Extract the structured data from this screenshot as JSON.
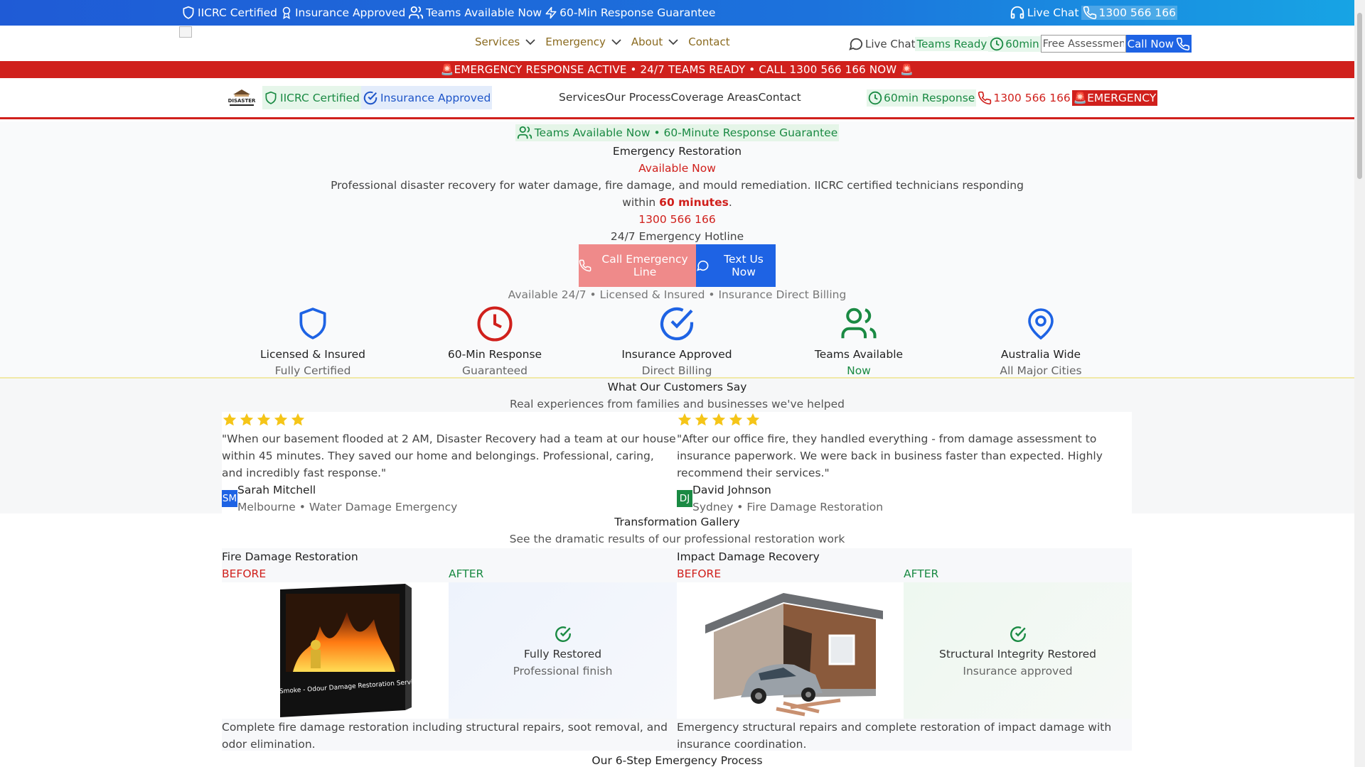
{
  "topbar": {
    "iicrc": "IICRC Certified",
    "insurance": "Insurance Approved",
    "teams": "Teams Available Now",
    "guarantee": "60-Min Response Guarantee",
    "live_chat": "Live Chat",
    "phone": "1300 566 166"
  },
  "nav": {
    "menu": [
      "Services",
      "Emergency",
      "About",
      "Contact"
    ],
    "live_chat": "Live Chat",
    "teams_ready": "Teams Ready",
    "mins": "60min",
    "free_assessment_value": "Free Assessment",
    "call_now": "Call Now"
  },
  "alert": {
    "text": "🚨EMERGENCY RESPONSE ACTIVE • 24/7 TEAMS READY • CALL 1300 566 166 NOW 🚨"
  },
  "nav2": {
    "brand_logo_text": "DISASTER",
    "badge_iicrc": "IICRC Certified",
    "badge_insurance": "Insurance Approved",
    "links": [
      "Services",
      "Our Process",
      "Coverage Areas",
      "Contact"
    ],
    "response": "60min Response",
    "phone": "1300 566 166",
    "emergency": "🚨EMERGENCY"
  },
  "hero": {
    "pill": "Teams Available Now • 60-Minute Response Guarantee",
    "title": "Emergency Restoration",
    "subtitle": "Available Now",
    "desc_line1": "Professional disaster recovery for water damage, fire damage, and mould remediation. IICRC certified technicians responding",
    "desc_within": "within ",
    "desc_bold": "60 minutes",
    "desc_end": ".",
    "phone": "1300 566 166",
    "hotline": "24/7 Emergency Hotline",
    "btn_call": "Call Emergency Line",
    "btn_text": "Text Us Now",
    "availability": "Available 24/7 • Licensed & Insured • Insurance Direct Billing"
  },
  "features": [
    {
      "icon": "shield-icon",
      "title": "Licensed & Insured",
      "sub": "Fully Certified",
      "color": "#1e63e4",
      "sub_color": "#666666"
    },
    {
      "icon": "clock-icon",
      "title": "60-Min Response",
      "sub": "Guaranteed",
      "color": "#d0201c",
      "sub_color": "#666666"
    },
    {
      "icon": "check-circle-icon",
      "title": "Insurance Approved",
      "sub": "Direct Billing",
      "color": "#1e63e4",
      "sub_color": "#666666"
    },
    {
      "icon": "users-icon",
      "title": "Teams Available",
      "sub": "Now",
      "color": "#1a8a43",
      "sub_color": "#1a8a43"
    },
    {
      "icon": "map-pin-icon",
      "title": "Australia Wide",
      "sub": "All Major Cities",
      "color": "#1e63e4",
      "sub_color": "#666666"
    }
  ],
  "testimonials": {
    "heading": "What Our Customers Say",
    "subheading": "Real experiences from families and businesses we've helped",
    "items": [
      {
        "rating": 5,
        "quote": "\"When our basement flooded at 2 AM, Disaster Recovery had a team at our house within 45 minutes. They saved our home and belongings. Professional, caring, and incredibly fast response.\"",
        "initials": "SM",
        "name": "Sarah Mitchell",
        "meta": "Melbourne • Water Damage Emergency",
        "avatar_color": "#1e63e4"
      },
      {
        "rating": 5,
        "quote": "\"After our office fire, they handled everything - from damage assessment to insurance paperwork. We were back in business faster than expected. Highly recommend their services.\"",
        "initials": "DJ",
        "name": "David Johnson",
        "meta": "Sydney • Fire Damage Restoration",
        "avatar_color": "#1a8a43"
      }
    ]
  },
  "gallery": {
    "heading": "Transformation Gallery",
    "subheading": "See the dramatic results of our professional restoration work",
    "before_label": "BEFORE",
    "after_label": "AFTER",
    "items": [
      {
        "title": "Fire Damage Restoration",
        "image_caption": "Fire - Smoke - Odour Damage Restoration Services",
        "after_title": "Fully Restored",
        "after_sub": "Professional finish",
        "desc": "Complete fire damage restoration including structural repairs, soot removal, and odor elimination."
      },
      {
        "title": "Impact Damage Recovery",
        "after_title": "Structural Integrity Restored",
        "after_sub": "Insurance approved",
        "desc": "Emergency structural repairs and complete restoration of impact damage with insurance coordination."
      }
    ]
  },
  "process": {
    "heading": "Our 6-Step Emergency Process"
  }
}
